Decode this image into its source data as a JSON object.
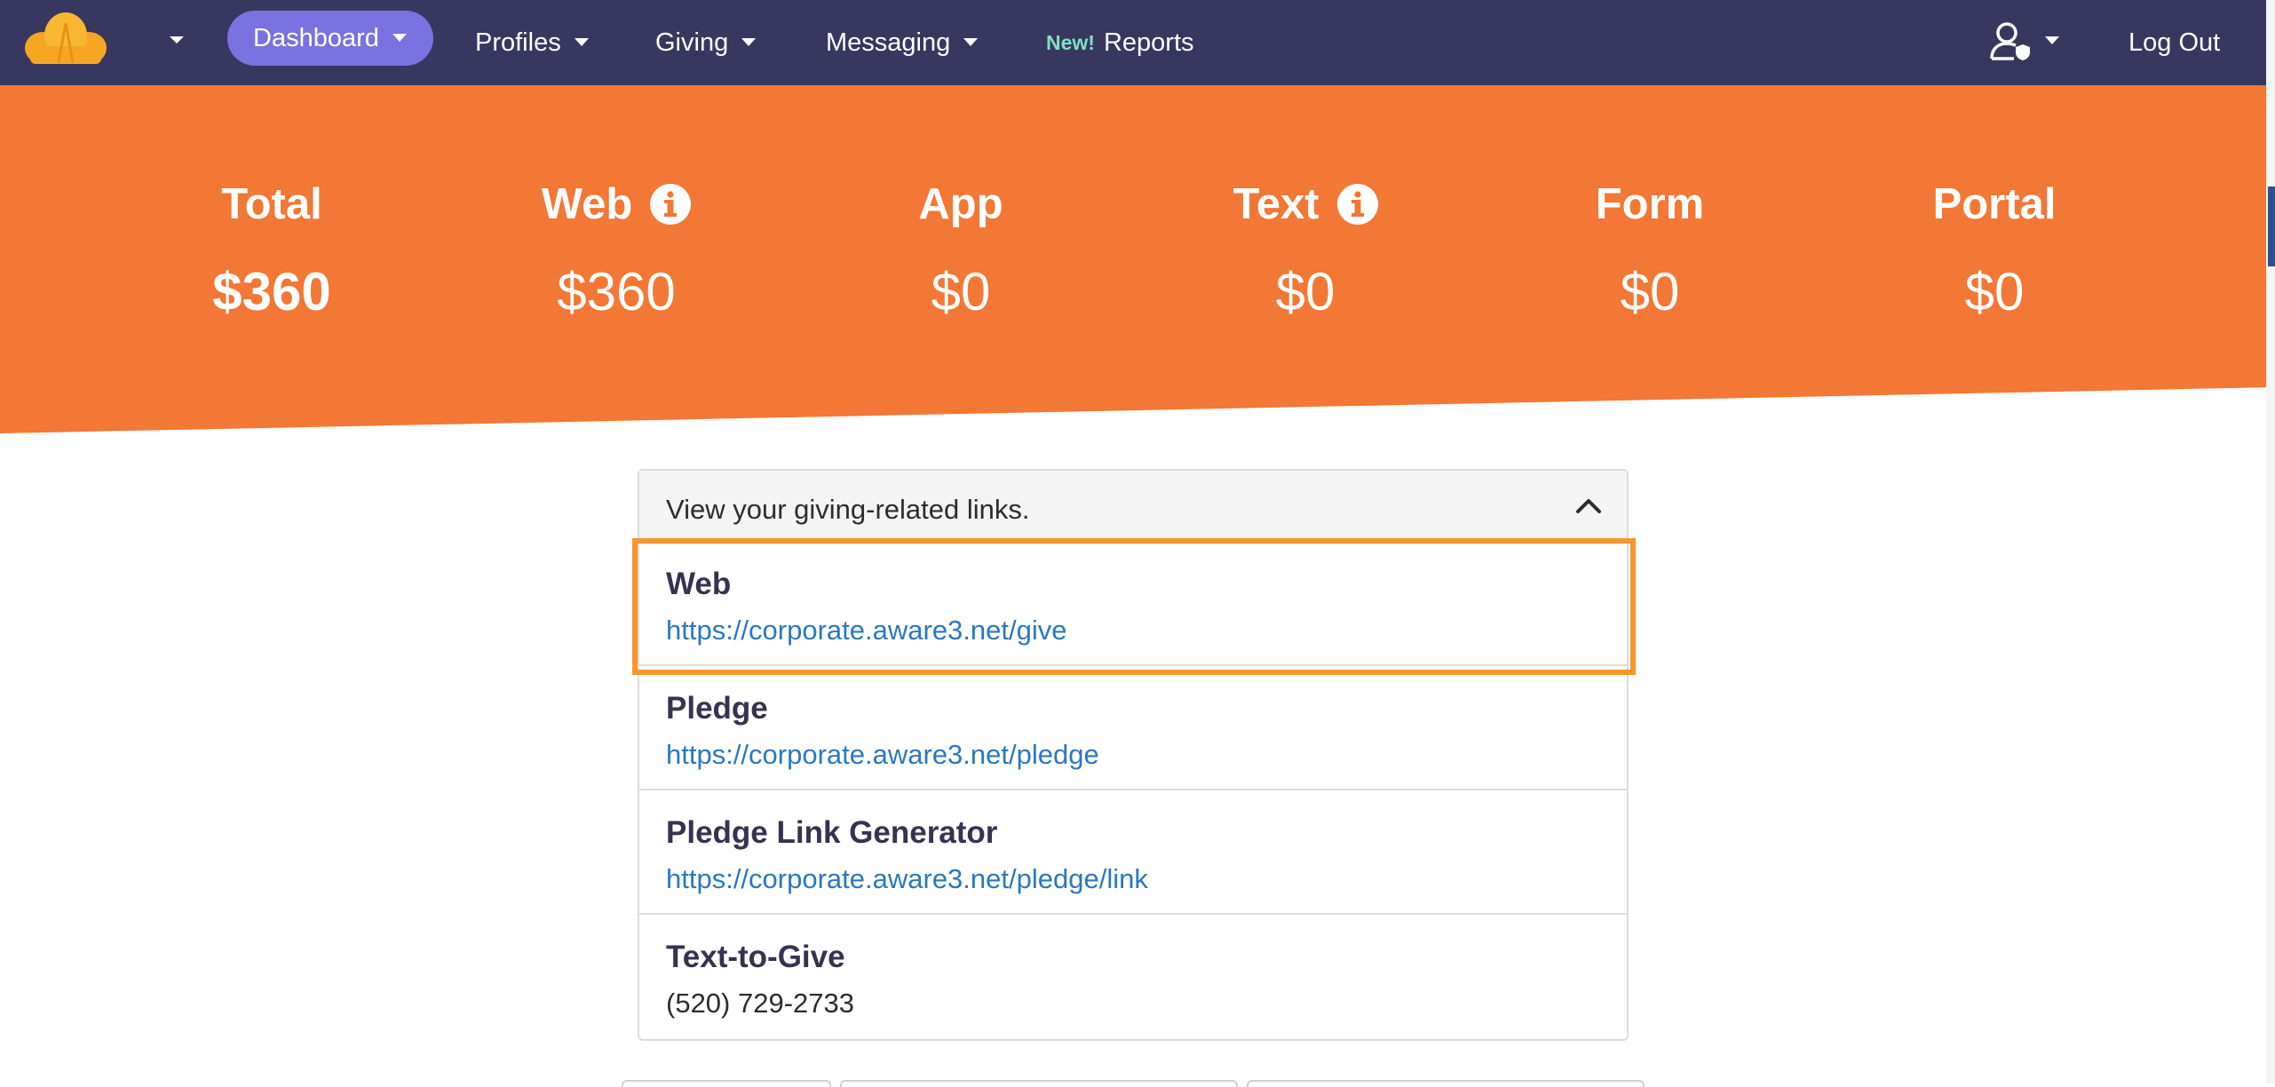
{
  "nav": {
    "items": [
      {
        "label": "Dashboard",
        "active": true,
        "has_caret": true
      },
      {
        "label": "Profiles",
        "active": false,
        "has_caret": true
      },
      {
        "label": "Giving",
        "active": false,
        "has_caret": true
      },
      {
        "label": "Messaging",
        "active": false,
        "has_caret": true
      }
    ],
    "reports": {
      "badge": "New!",
      "label": "Reports"
    },
    "logout_label": "Log Out",
    "icons": {
      "logo": "cloud-logo-icon",
      "user": "user-shield-icon",
      "caret": "chevron-down-icon"
    }
  },
  "stats": [
    {
      "label": "Total",
      "value": "$360",
      "info": false
    },
    {
      "label": "Web",
      "value": "$360",
      "info": true
    },
    {
      "label": "App",
      "value": "$0",
      "info": false
    },
    {
      "label": "Text",
      "value": "$0",
      "info": true
    },
    {
      "label": "Form",
      "value": "$0",
      "info": false
    },
    {
      "label": "Portal",
      "value": "$0",
      "info": false
    }
  ],
  "links_card": {
    "header": "View your giving-related links.",
    "rows": [
      {
        "title": "Web",
        "value": "https://corporate.aware3.net/give",
        "highlighted": true
      },
      {
        "title": "Pledge",
        "value": "https://corporate.aware3.net/pledge",
        "highlighted": false
      },
      {
        "title": "Pledge Link Generator",
        "value": "https://corporate.aware3.net/pledge/link",
        "highlighted": false
      },
      {
        "title": "Text-to-Give",
        "value": "(520) 729-2733",
        "highlighted": false
      }
    ]
  },
  "colors": {
    "nav_bg": "#38375f",
    "nav_active": "#7a72e0",
    "banner": "#f37735",
    "link": "#2a78c2",
    "highlight": "#f7962d",
    "new_badge": "#7ee2c0"
  }
}
